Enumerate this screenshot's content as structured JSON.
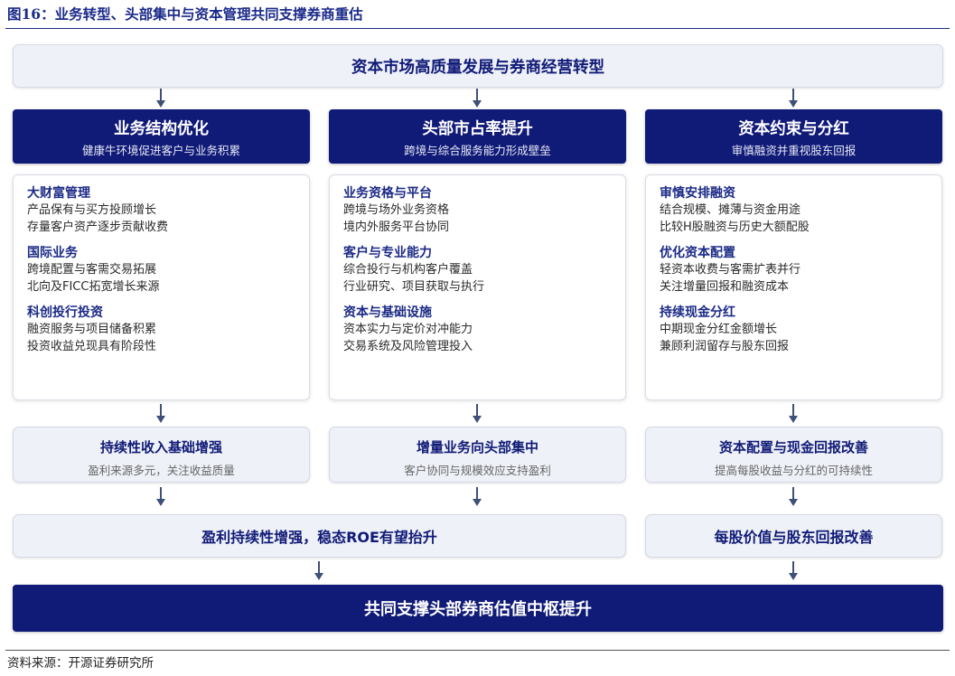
{
  "figure_title": "图16：业务转型、头部集中与资本管理共同支撑券商重估",
  "top_banner": "资本市场高质量发展与券商经营转型",
  "columns": [
    {
      "title": "业务结构优化",
      "subtitle": "健康牛环境促进客户与业务积累",
      "groups": [
        {
          "heading": "大财富管理",
          "items": [
            "产品保有与买方投顾增长",
            "存量客户资产逐步贡献收费"
          ]
        },
        {
          "heading": "国际业务",
          "items": [
            "跨境配置与客需交易拓展",
            "北向及FICC拓宽增长来源"
          ]
        },
        {
          "heading": "科创投行投资",
          "items": [
            "融资服务与项目储备积累",
            "投资收益兑现具有阶段性"
          ]
        }
      ],
      "result_title": "持续性收入基础增强",
      "result_sub": "盈利来源多元，关注收益质量"
    },
    {
      "title": "头部市占率提升",
      "subtitle": "跨境与综合服务能力形成壁垒",
      "groups": [
        {
          "heading": "业务资格与平台",
          "items": [
            "跨境与场外业务资格",
            "境内外服务平台协同"
          ]
        },
        {
          "heading": "客户与专业能力",
          "items": [
            "综合投行与机构客户覆盖",
            "行业研究、项目获取与执行"
          ]
        },
        {
          "heading": "资本与基础设施",
          "items": [
            "资本实力与定价对冲能力",
            "交易系统及风险管理投入"
          ]
        }
      ],
      "result_title": "增量业务向头部集中",
      "result_sub": "客户协同与规模效应支持盈利"
    },
    {
      "title": "资本约束与分红",
      "subtitle": "审慎融资并重视股东回报",
      "groups": [
        {
          "heading": "审慎安排融资",
          "items": [
            "结合规模、摊薄与资金用途",
            "比较H股融资与历史大额配股"
          ]
        },
        {
          "heading": "优化资本配置",
          "items": [
            "轻资本收费与客需扩表并行",
            "关注增量回报和融资成本"
          ]
        },
        {
          "heading": "持续现金分红",
          "items": [
            "中期现金分红金额增长",
            "兼顾利润留存与股东回报"
          ]
        }
      ],
      "result_title": "资本配置与现金回报改善",
      "result_sub": "提高每股收益与分红的可持续性"
    }
  ],
  "merge_left": "盈利持续性增强，稳态ROE有望抬升",
  "merge_right": "每股价值与股东回报改善",
  "bottom_banner": "共同支撑头部券商估值中枢提升",
  "source": "资料来源：开源证券研究所",
  "colors": {
    "navy": "#101a77",
    "pale": "#eef1f7",
    "heading": "#1b2a86",
    "arrow": "#3e4f78"
  }
}
